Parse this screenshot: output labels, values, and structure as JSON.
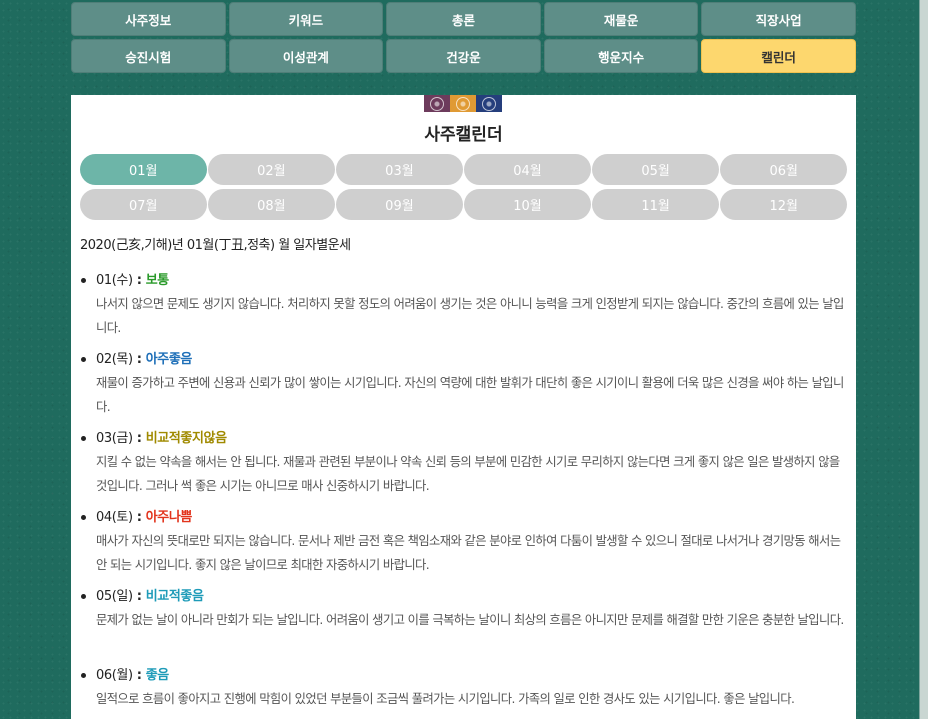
{
  "nav": {
    "row1": [
      "사주정보",
      "키워드",
      "총론",
      "재물운",
      "직장사업"
    ],
    "row2": [
      "승진시험",
      "이성관계",
      "건강운",
      "행운지수",
      "캘린더"
    ],
    "active": "캘린더"
  },
  "icon_colors": [
    "#6d3b5c",
    "#e09a34",
    "#253e7c"
  ],
  "calendar": {
    "title": "사주캘린더",
    "months": [
      "01월",
      "02월",
      "03월",
      "04월",
      "05월",
      "06월",
      "07월",
      "08월",
      "09월",
      "10월",
      "11월",
      "12월"
    ],
    "active_month": "01월",
    "heading": "2020(己亥,기해)년 01월(丁丑,정축) 월 일자별운세",
    "days": [
      {
        "date": "01(수)",
        "sep": " : ",
        "rating": "보통",
        "color": "#2a9a2a",
        "desc": "나서지 않으면 문제도 생기지 않습니다. 처리하지 못할 정도의 어려움이 생기는 것은 아니니 능력을 크게 인정받게 되지는 않습니다. 중간의 흐름에 있는 날입니다."
      },
      {
        "date": "02(목)",
        "sep": " : ",
        "rating": "아주좋음",
        "color": "#1e6fb8",
        "desc": "재물이 증가하고 주변에 신용과 신뢰가 많이 쌓이는 시기입니다. 자신의 역량에 대한 발휘가 대단히 좋은 시기이니 활용에 더욱 많은 신경을 써야 하는 날입니다."
      },
      {
        "date": "03(금)",
        "sep": " : ",
        "rating": "비교적좋지않음",
        "color": "#a08a00",
        "desc": "지킬 수 없는 약속을 해서는 안 됩니다. 재물과 관련된 부분이나 약속 신뢰 등의 부분에 민감한 시기로 무리하지 않는다면 크게 좋지 않은 일은 발생하지 않을 것입니다. 그러나 썩 좋은 시기는 아니므로 매사 신중하시기 바랍니다."
      },
      {
        "date": "04(토)",
        "sep": " : ",
        "rating": "아주나쁨",
        "color": "#e2341d",
        "desc": "매사가 자신의 뜻대로만 되지는 않습니다. 문서나 제반 금전 혹은 책임소재와 같은 분야로 인하여 다툼이 발생할 수 있으니 절대로 나서거나 경기망동 해서는 안 되는 시기입니다. 좋지 않은 날이므로 최대한 자중하시기 바랍니다."
      },
      {
        "date": "05(일)",
        "sep": " : ",
        "rating": "비교적좋음",
        "color": "#1e9bb8",
        "desc": "문제가 없는 날이 아니라 만회가 되는 날입니다. 어려움이 생기고 이를 극복하는 날이니 최상의 흐름은 아니지만 문제를 해결할 만한 기운은 충분한 날입니다."
      },
      {
        "date": "06(월)",
        "sep": " : ",
        "rating": "좋음",
        "color": "#1e9bb8",
        "desc": "일적으로 흐름이 좋아지고 진행에 막힘이 있었던 부분들이 조금씩 풀려가는 시기입니다. 가족의 일로 인한 경사도 있는 시기입니다. 좋은 날입니다."
      }
    ]
  }
}
